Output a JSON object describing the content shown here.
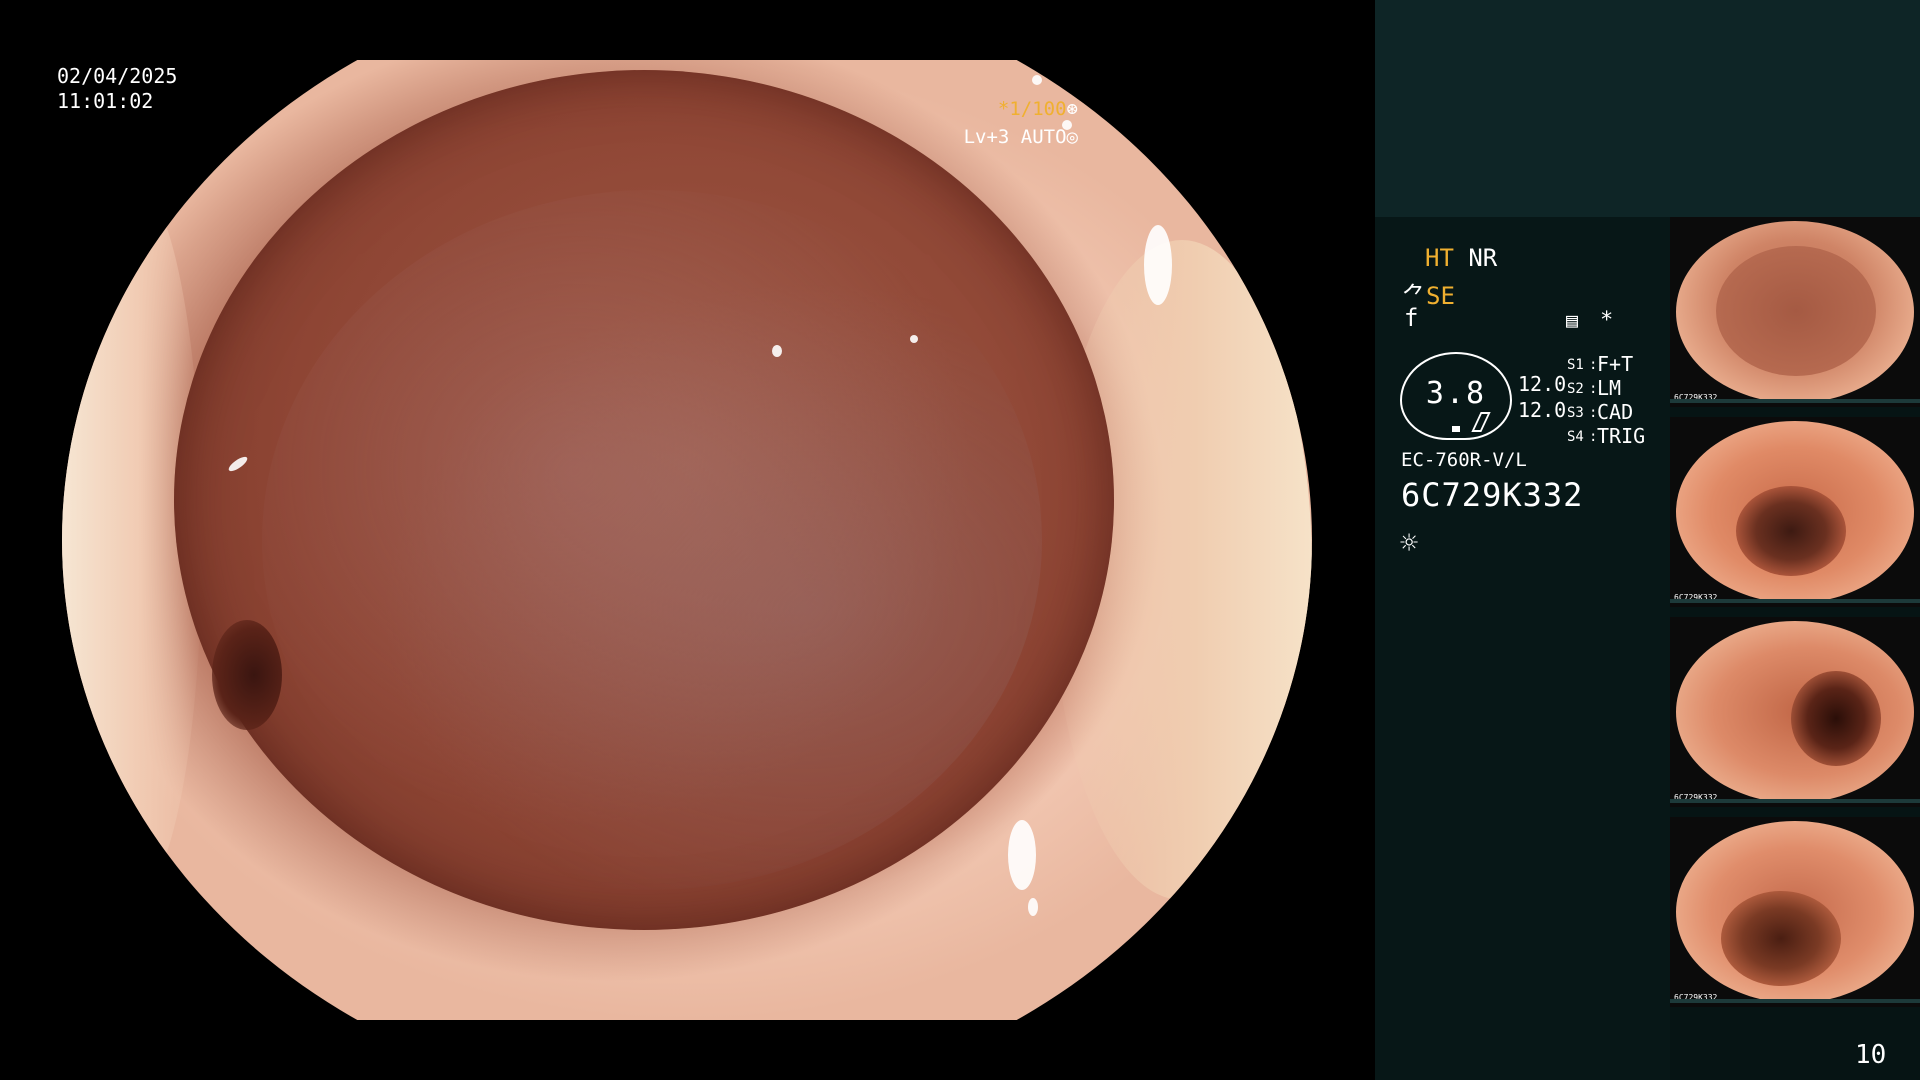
{
  "main_view": {
    "date": "02/04/2025",
    "time": "11:01:02",
    "shutter": "*1/100",
    "shutter_icon": "aperture-icon",
    "iris": "Lv+3 AUTO",
    "iris_icon": "target-icon"
  },
  "info_panel": {
    "ht_label": "HT",
    "nr_label": "NR",
    "se_prefix": "⺈",
    "se_label": "SE",
    "f_label": "f",
    "memo_icon": "memo-icon",
    "asterisk": "*",
    "gauge_value": "3.8",
    "value_1": "12.0",
    "value_2": "12.0",
    "switches": [
      {
        "key": "S1",
        "value": "F+T"
      },
      {
        "key": "S2",
        "value": "LM"
      },
      {
        "key": "S3",
        "value": "CAD"
      },
      {
        "key": "S4",
        "value": "TRIG"
      }
    ],
    "model": "EC-760R-V/L",
    "serial": "6C729K332",
    "light_icon": "sun-icon"
  },
  "thumbnails": [
    {
      "label": "6C729K332"
    },
    {
      "label": "6C729K332"
    },
    {
      "label": "6C729K332"
    },
    {
      "label": "6C729K332"
    }
  ],
  "page_number": "10",
  "colors": {
    "accent": "#f0b030",
    "panel_top": "#0e2526",
    "panel_info": "#071717"
  }
}
